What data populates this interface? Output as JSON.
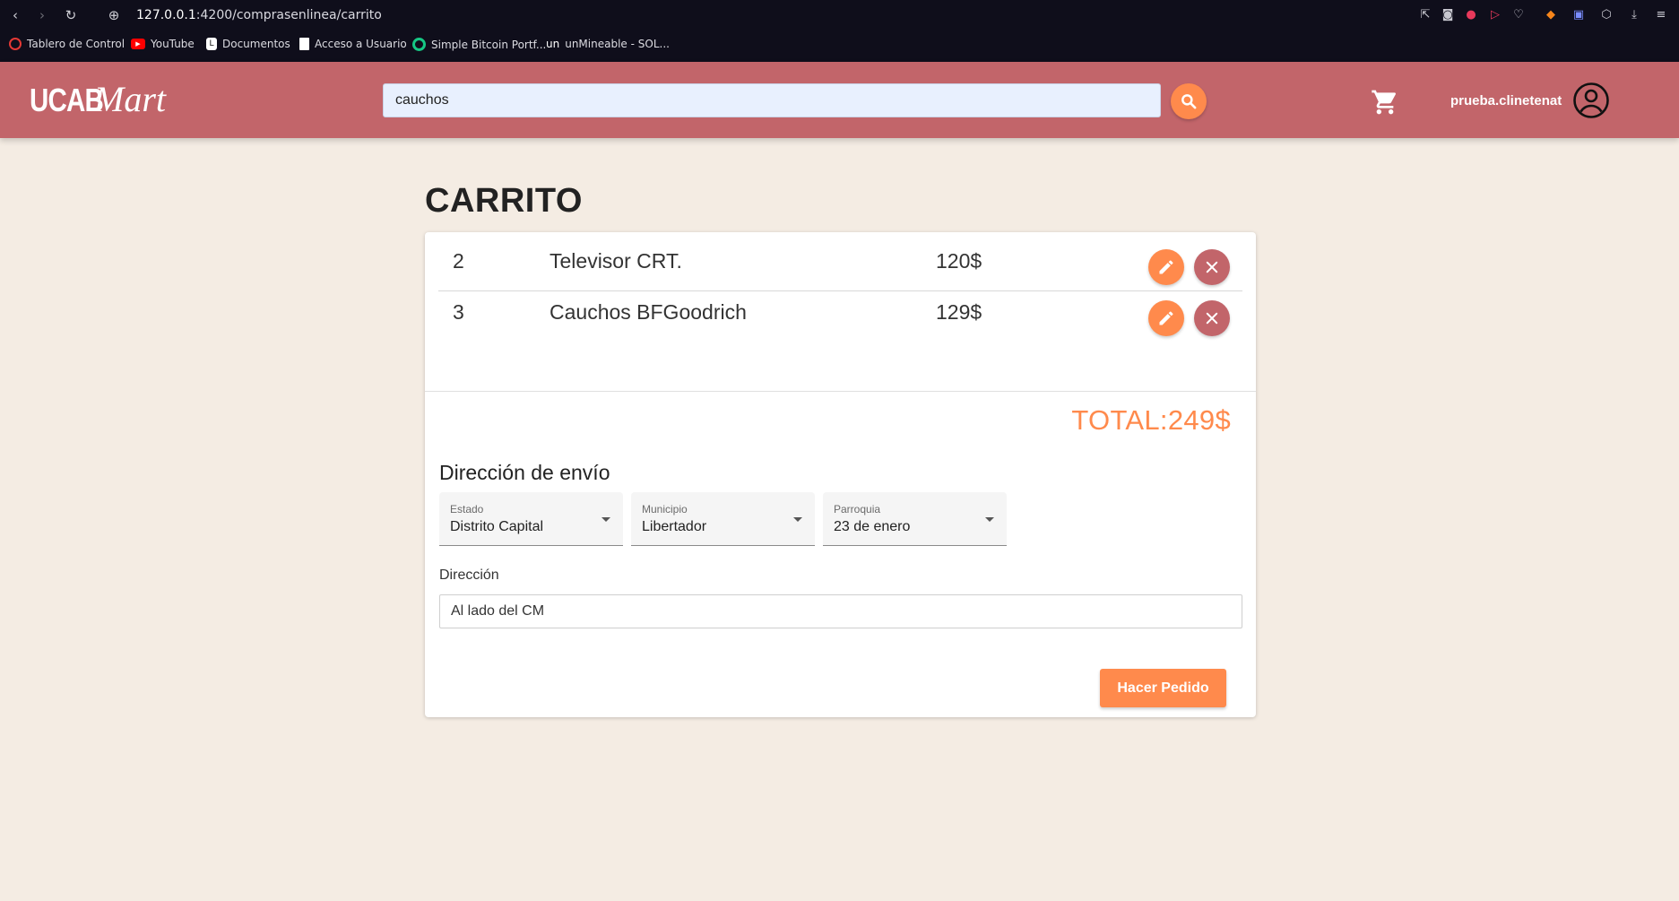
{
  "browser": {
    "url_host": "127.0.0.1",
    "url_path": ":4200/comprasenlinea/carrito",
    "bookmarks": [
      {
        "label": "Tablero de Control",
        "icon": "dashboard-icon",
        "color": "#e53935"
      },
      {
        "label": "YouTube",
        "icon": "youtube-icon",
        "color": "#ff0000"
      },
      {
        "label": "Documentos",
        "icon": "document-icon",
        "color": "#ffffff"
      },
      {
        "label": "Acceso a Usuario",
        "icon": "file-icon",
        "color": "#ffffff"
      },
      {
        "label": "Simple Bitcoin Portf...",
        "icon": "bitcoin-icon",
        "color": "#16c784"
      },
      {
        "label": "unMineable - SOL...",
        "icon": "unmineable-icon",
        "color": "#ffffff",
        "prefix": "un"
      }
    ]
  },
  "header": {
    "logo_part1": "UCAB",
    "logo_part2": "Mart",
    "search_value": "cauchos",
    "username": "prueba.clinetenat",
    "brand_color": "#c2656a",
    "accent_color": "#ff8a4c"
  },
  "main": {
    "title": "CARRITO",
    "items": [
      {
        "qty": "2",
        "name": "Televisor CRT.",
        "price": "120$"
      },
      {
        "qty": "3",
        "name": "Cauchos BFGoodrich",
        "price": "129$"
      }
    ],
    "total": "TOTAL:249$",
    "shipping_title": "Dirección de envío",
    "selects": [
      {
        "label": "Estado",
        "value": "Distrito Capital"
      },
      {
        "label": "Municipio",
        "value": "Libertador"
      },
      {
        "label": "Parroquia",
        "value": "23 de enero"
      }
    ],
    "address_label": "Dirección",
    "address_value": "Al lado del CM",
    "order_button": "Hacer Pedido"
  }
}
